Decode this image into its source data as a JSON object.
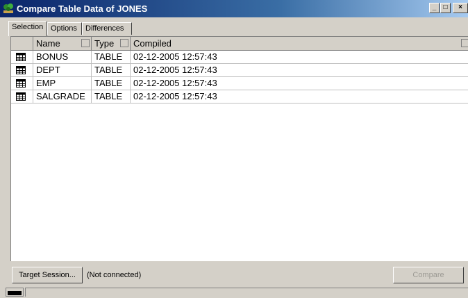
{
  "window": {
    "title": "Compare Table Data of JONES",
    "icon": "app-tree-icon",
    "controls": {
      "minimize": "_",
      "maximize": "□",
      "close": "×"
    }
  },
  "tabs": [
    {
      "label": "Selection",
      "active": true
    },
    {
      "label": "Options",
      "active": false
    },
    {
      "label": "Differences",
      "active": false
    }
  ],
  "grid": {
    "columns": [
      "Name",
      "Type",
      "Compiled"
    ],
    "rows": [
      {
        "icon": "table-icon",
        "name": "BONUS",
        "type": "TABLE",
        "compiled": "02-12-2005 12:57:43"
      },
      {
        "icon": "table-icon",
        "name": "DEPT",
        "type": "TABLE",
        "compiled": "02-12-2005 12:57:43"
      },
      {
        "icon": "table-icon",
        "name": "EMP",
        "type": "TABLE",
        "compiled": "02-12-2005 12:57:43"
      },
      {
        "icon": "table-icon",
        "name": "SALGRADE",
        "type": "TABLE",
        "compiled": "02-12-2005 12:57:43"
      }
    ]
  },
  "bottom": {
    "target_session_label": "Target Session...",
    "connection_status": "(Not connected)",
    "compare_label": "Compare",
    "compare_enabled": false
  },
  "colors": {
    "title_start": "#0a246a",
    "title_end": "#a6caf0",
    "chrome": "#d4d0c8"
  }
}
